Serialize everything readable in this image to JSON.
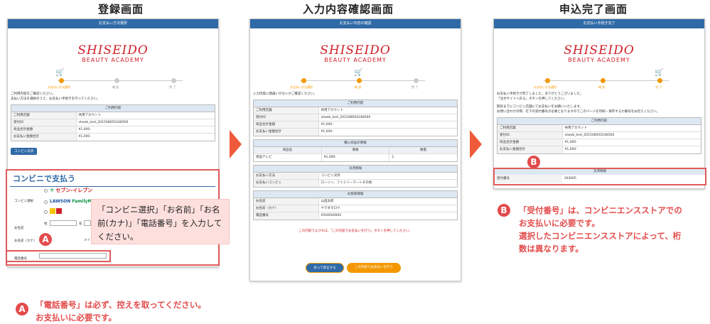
{
  "columns": {
    "col1_title": "登録画面",
    "col2_title": "入力内容確認画面",
    "col3_title": "申込完了画面"
  },
  "brand": {
    "logo_main": "SHISEIDO",
    "logo_sub": "BEAUTY ACADEMY",
    "color_red": "#d01e26",
    "color_blue": "#2f6aa7",
    "color_orange": "#f39800"
  },
  "screen1": {
    "bar": "お支払い方法選択",
    "steps": [
      "お支払い方法選択",
      "確 認",
      "完 了"
    ],
    "msg": [
      "ご利用内容をご確認ください。",
      "支払い方法を選択のうえ、お支払い手続きを行ってください。"
    ],
    "table_header": "ご利用内容",
    "rows": [
      {
        "k": "ご利用店舗",
        "v": "共用アカウント"
      },
      {
        "k": "受付ID",
        "v": "vtweb_test_20150805024856​0"
      },
      {
        "k": "商品合計金額",
        "v": "¥1,000-"
      },
      {
        "k": "お支払い金額合計",
        "v": "¥1,000-"
      }
    ],
    "conv_button": "コンビニ決済",
    "pay_title": "コンビニで支払う",
    "label_store": "コンビニ選択",
    "label_name": "お名前",
    "label_kana": "お名前（カナ）",
    "label_phone": "電話番号",
    "store1": "セブン-イレブン",
    "store2": "LAWSON",
    "store3": "FamilyMart",
    "name_sei": "姓",
    "name_mei": "名",
    "kana_mei": "メイ",
    "callout": "「コンビニ選択」「お名前」「お名前(カナ)」「電話番号」を入力してください。"
  },
  "screen2": {
    "bar": "お支払い内容の確認",
    "steps": [
      "お支払い方法選択",
      "確 認",
      "完 了"
    ],
    "msg": "入力内容に間違いがないかご確認ください。",
    "table1_header": "ご利用内容",
    "rows1": [
      {
        "k": "ご利用店舗",
        "v": "共用アカウント"
      },
      {
        "k": "受付ID",
        "v": "vtweb_test_20150805024856​0"
      },
      {
        "k": "商品合計金額",
        "v": "¥1,000-"
      },
      {
        "k": "お支払い金額合計",
        "v": "¥1,000-"
      }
    ],
    "table2_header": "購入商品の情報",
    "cols2": [
      "商品名",
      "価格",
      "数量"
    ],
    "item": {
      "name": "液晶テレビ",
      "price": "¥1,000-",
      "qty": "1"
    },
    "table3_header": "決済情報",
    "rows3": [
      {
        "k": "お支払い方法",
        "v": "コンビニ決済"
      },
      {
        "k": "お支払いコンビニ",
        "v": "ローソン、ファミリーマートその他"
      }
    ],
    "table4_header": "お客様情報",
    "rows4": [
      {
        "k": "お名前",
        "v": "山田太郎"
      },
      {
        "k": "お名前（カナ）",
        "v": "ヤマダタロウ"
      },
      {
        "k": "電話番号",
        "v": "0500000000"
      }
    ],
    "red_note": "この内容でよければ、「この内容でお支払いを行う」ボタンを押してください。",
    "btn_back": "戻って修正する",
    "btn_confirm": "この内容でお支払いを行う"
  },
  "screen3": {
    "bar": "お支払い手続き完了",
    "steps": [
      "お支払い方法選択",
      "確 認",
      "完 了"
    ],
    "msg": [
      "お支払い手続きが完了しました。ありがとうございました。",
      "「注文サイトへ戻る」ボタンを押してください。",
      "",
      "期日までにコンビニ店舗にてお支払いをお願いいたします。",
      "お問い合わせの際、在下の受付番号が必要となりますのでこのページを印刷・保存するか番号をお控えください。"
    ],
    "table_header": "ご利用内容",
    "rows": [
      {
        "k": "ご利用店舗",
        "v": "共用アカウント"
      },
      {
        "k": "受付ID",
        "v": "vtweb_test_20150805024856​0"
      },
      {
        "k": "商品合計金額",
        "v": "¥1,000-"
      },
      {
        "k": "お支払い金額合計",
        "v": "¥1,000-"
      }
    ],
    "pay_header": "決済情報",
    "receipt_label": "受付番号",
    "receipt_value": "303005"
  },
  "notes": {
    "a_badge": "A",
    "b_badge": "B",
    "a_line1": "「電話番号」は必ず、控えを取ってください。",
    "a_line2": "お支払いに必要です。",
    "b_line1": "「受付番号」は、コンビニエンスストアでの",
    "b_line2": "お支払いに必要です。",
    "b_line3": "選択したコンビニエンスストアによって、桁",
    "b_line4": "数は異なります。"
  }
}
